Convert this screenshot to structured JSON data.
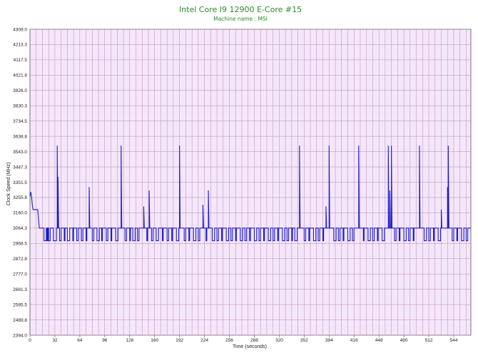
{
  "chart_data": {
    "type": "line",
    "title": "Intel Core I9 12900 E-Core #15",
    "subtitle": "Machine name : MSI",
    "xlabel": "Time (seconds)",
    "ylabel": "Clock Speed (MHz)",
    "xlim": [
      0,
      566
    ],
    "ylim": [
      2394.0,
      4309.0
    ],
    "x_ticks": [
      "0",
      "32",
      "64",
      "96",
      "128",
      "160",
      "192",
      "224",
      "256",
      "288",
      "320",
      "352",
      "384",
      "416",
      "448",
      "480",
      "512",
      "544"
    ],
    "y_ticks": [
      "2394.0",
      "2489.8",
      "2585.5",
      "2681.3",
      "2777.0",
      "2872.8",
      "2968.5",
      "3064.3",
      "3160.0",
      "3255.8",
      "3351.5",
      "3447.3",
      "3543.0",
      "3638.8",
      "3734.5",
      "3830.3",
      "3926.0",
      "4021.8",
      "4117.5",
      "4213.3",
      "4309.0"
    ],
    "grid": true,
    "background_color": "#f5e6fa",
    "grid_color": "#b48cb4",
    "line_color": "#1a1acc",
    "series": [
      {
        "baseline": 3064.3,
        "low_level": 2985.0,
        "initial": [
          [
            0,
            3262
          ],
          [
            1,
            3290
          ],
          [
            2,
            3262
          ],
          [
            3,
            3210
          ],
          [
            4,
            3180
          ],
          [
            10,
            3180
          ],
          [
            11,
            3120
          ],
          [
            12,
            3064.3
          ]
        ],
        "spikes": [
          [
            35,
            3580
          ],
          [
            36,
            3385
          ],
          [
            76,
            3320
          ],
          [
            117,
            3580
          ],
          [
            146,
            3200
          ],
          [
            153,
            3300
          ],
          [
            192,
            3580
          ],
          [
            222,
            3210
          ],
          [
            229,
            3300
          ],
          [
            346,
            3580
          ],
          [
            380,
            3200
          ],
          [
            384,
            3580
          ],
          [
            422,
            3580
          ],
          [
            460,
            3580
          ],
          [
            462,
            3300
          ],
          [
            464,
            3580
          ],
          [
            500,
            3580
          ],
          [
            528,
            3180
          ],
          [
            537,
            3580
          ],
          [
            536,
            3320
          ]
        ],
        "dips": [
          [
            18,
            3
          ],
          [
            22,
            1
          ],
          [
            24,
            2
          ],
          [
            30,
            4
          ],
          [
            38,
            2
          ],
          [
            44,
            1
          ],
          [
            48,
            3
          ],
          [
            55,
            1
          ],
          [
            60,
            2
          ],
          [
            66,
            2
          ],
          [
            72,
            1
          ],
          [
            80,
            2
          ],
          [
            86,
            3
          ],
          [
            92,
            1
          ],
          [
            98,
            2
          ],
          [
            104,
            1
          ],
          [
            110,
            3
          ],
          [
            122,
            2
          ],
          [
            128,
            1
          ],
          [
            132,
            3
          ],
          [
            138,
            2
          ],
          [
            150,
            1
          ],
          [
            156,
            2
          ],
          [
            162,
            3
          ],
          [
            170,
            1
          ],
          [
            176,
            2
          ],
          [
            182,
            1
          ],
          [
            188,
            3
          ],
          [
            198,
            2
          ],
          [
            204,
            1
          ],
          [
            210,
            3
          ],
          [
            216,
            2
          ],
          [
            226,
            1
          ],
          [
            234,
            3
          ],
          [
            240,
            2
          ],
          [
            246,
            1
          ],
          [
            252,
            3
          ],
          [
            258,
            2
          ],
          [
            264,
            1
          ],
          [
            270,
            3
          ],
          [
            276,
            2
          ],
          [
            282,
            1
          ],
          [
            288,
            3
          ],
          [
            294,
            2
          ],
          [
            300,
            1
          ],
          [
            306,
            3
          ],
          [
            312,
            2
          ],
          [
            318,
            1
          ],
          [
            324,
            3
          ],
          [
            330,
            2
          ],
          [
            336,
            1
          ],
          [
            340,
            3
          ],
          [
            352,
            2
          ],
          [
            358,
            1
          ],
          [
            364,
            3
          ],
          [
            370,
            2
          ],
          [
            376,
            1
          ],
          [
            390,
            3
          ],
          [
            396,
            2
          ],
          [
            402,
            1
          ],
          [
            408,
            3
          ],
          [
            414,
            2
          ],
          [
            428,
            1
          ],
          [
            434,
            3
          ],
          [
            440,
            2
          ],
          [
            446,
            1
          ],
          [
            452,
            3
          ],
          [
            468,
            2
          ],
          [
            474,
            1
          ],
          [
            480,
            3
          ],
          [
            486,
            2
          ],
          [
            492,
            1
          ],
          [
            506,
            3
          ],
          [
            512,
            2
          ],
          [
            518,
            1
          ],
          [
            524,
            3
          ],
          [
            542,
            2
          ],
          [
            548,
            1
          ],
          [
            554,
            3
          ],
          [
            560,
            2
          ]
        ]
      }
    ]
  }
}
